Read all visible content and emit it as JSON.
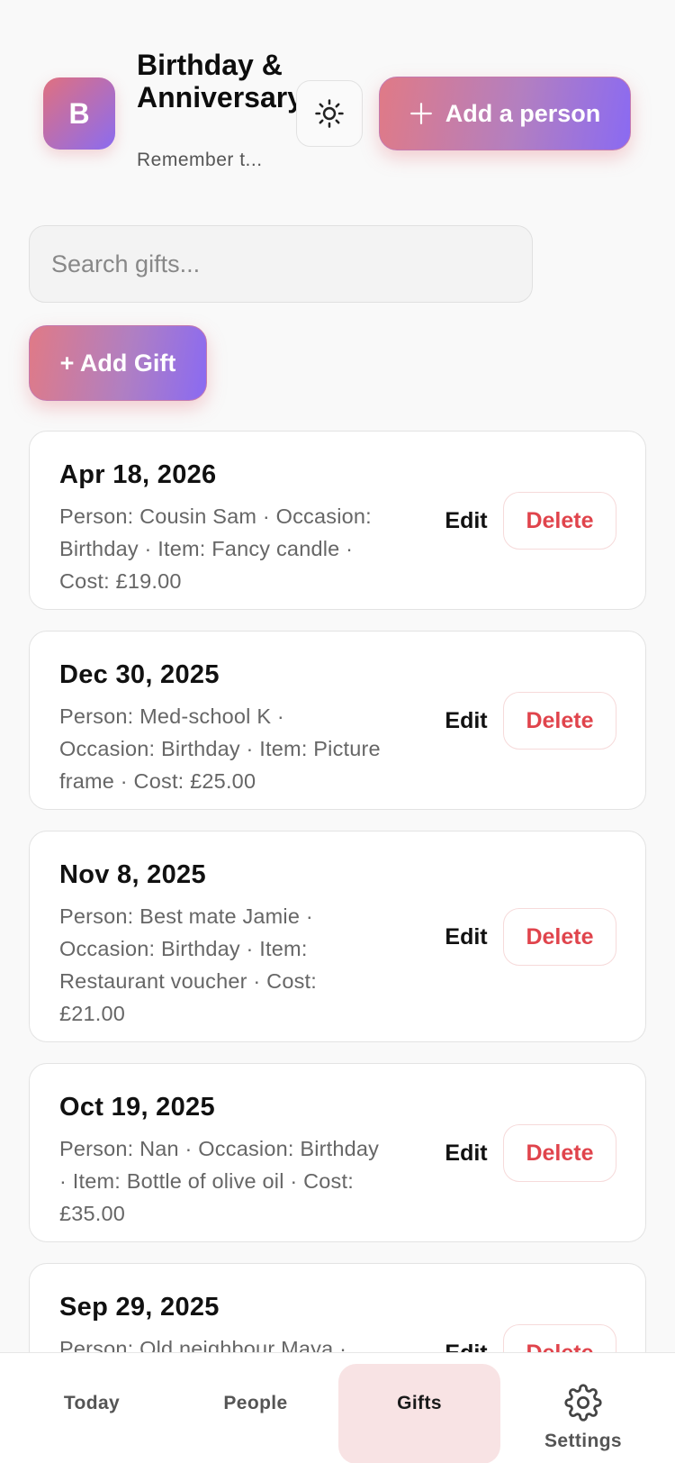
{
  "header": {
    "logo_letter": "B",
    "title": "Birthday & Anniversary",
    "subtitle": "Remember t...",
    "theme_toggle_icon": "sun-icon",
    "add_person_label": "Add a person"
  },
  "search": {
    "placeholder": "Search gifts..."
  },
  "add_gift_label": "+ Add Gift",
  "gifts": [
    {
      "date": "Apr 18, 2026",
      "details": "Person: Cousin Sam · Occasion: Birthday · Item: Fancy candle · Cost: £19.00",
      "edit_label": "Edit",
      "delete_label": "Delete"
    },
    {
      "date": "Dec 30, 2025",
      "details": "Person: Med-school K · Occasion: Birthday · Item: Picture frame · Cost: £25.00",
      "edit_label": "Edit",
      "delete_label": "Delete"
    },
    {
      "date": "Nov 8, 2025",
      "details": "Person: Best mate Jamie · Occasion: Birthday · Item: Restaurant voucher · Cost: £21.00",
      "edit_label": "Edit",
      "delete_label": "Delete"
    },
    {
      "date": "Oct 19, 2025",
      "details": "Person: Nan · Occasion: Birthday · Item: Bottle of olive oil · Cost: £35.00",
      "edit_label": "Edit",
      "delete_label": "Delete"
    },
    {
      "date": "Sep 29, 2025",
      "details": "Person: Old neighbour Maya ·",
      "edit_label": "Edit",
      "delete_label": "Delete"
    }
  ],
  "tabs": [
    {
      "label": "Today",
      "active": false
    },
    {
      "label": "People",
      "active": false
    },
    {
      "label": "Gifts",
      "active": true
    },
    {
      "label": "Settings",
      "active": false,
      "icon": "gear-icon"
    }
  ],
  "colors": {
    "accent_start": "#e07a86",
    "accent_end": "#8a6af2",
    "delete": "#e0444c",
    "active_tab_bg": "#f8e3e4"
  }
}
